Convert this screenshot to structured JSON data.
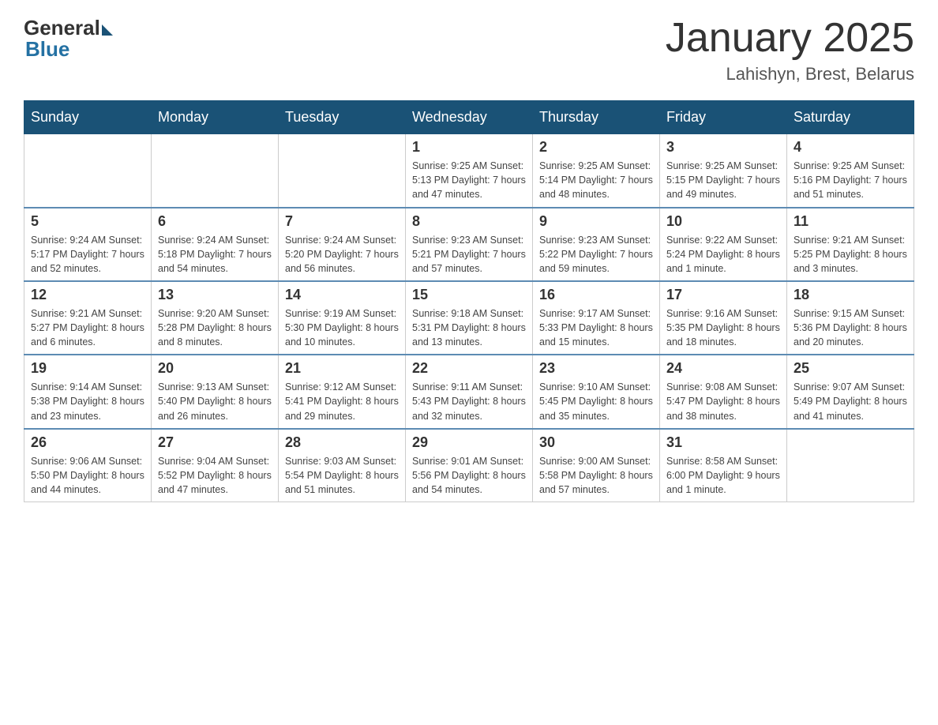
{
  "logo": {
    "general": "General",
    "blue": "Blue"
  },
  "title": "January 2025",
  "location": "Lahishyn, Brest, Belarus",
  "days_of_week": [
    "Sunday",
    "Monday",
    "Tuesday",
    "Wednesday",
    "Thursday",
    "Friday",
    "Saturday"
  ],
  "weeks": [
    [
      {
        "day": "",
        "info": ""
      },
      {
        "day": "",
        "info": ""
      },
      {
        "day": "",
        "info": ""
      },
      {
        "day": "1",
        "info": "Sunrise: 9:25 AM\nSunset: 5:13 PM\nDaylight: 7 hours\nand 47 minutes."
      },
      {
        "day": "2",
        "info": "Sunrise: 9:25 AM\nSunset: 5:14 PM\nDaylight: 7 hours\nand 48 minutes."
      },
      {
        "day": "3",
        "info": "Sunrise: 9:25 AM\nSunset: 5:15 PM\nDaylight: 7 hours\nand 49 minutes."
      },
      {
        "day": "4",
        "info": "Sunrise: 9:25 AM\nSunset: 5:16 PM\nDaylight: 7 hours\nand 51 minutes."
      }
    ],
    [
      {
        "day": "5",
        "info": "Sunrise: 9:24 AM\nSunset: 5:17 PM\nDaylight: 7 hours\nand 52 minutes."
      },
      {
        "day": "6",
        "info": "Sunrise: 9:24 AM\nSunset: 5:18 PM\nDaylight: 7 hours\nand 54 minutes."
      },
      {
        "day": "7",
        "info": "Sunrise: 9:24 AM\nSunset: 5:20 PM\nDaylight: 7 hours\nand 56 minutes."
      },
      {
        "day": "8",
        "info": "Sunrise: 9:23 AM\nSunset: 5:21 PM\nDaylight: 7 hours\nand 57 minutes."
      },
      {
        "day": "9",
        "info": "Sunrise: 9:23 AM\nSunset: 5:22 PM\nDaylight: 7 hours\nand 59 minutes."
      },
      {
        "day": "10",
        "info": "Sunrise: 9:22 AM\nSunset: 5:24 PM\nDaylight: 8 hours\nand 1 minute."
      },
      {
        "day": "11",
        "info": "Sunrise: 9:21 AM\nSunset: 5:25 PM\nDaylight: 8 hours\nand 3 minutes."
      }
    ],
    [
      {
        "day": "12",
        "info": "Sunrise: 9:21 AM\nSunset: 5:27 PM\nDaylight: 8 hours\nand 6 minutes."
      },
      {
        "day": "13",
        "info": "Sunrise: 9:20 AM\nSunset: 5:28 PM\nDaylight: 8 hours\nand 8 minutes."
      },
      {
        "day": "14",
        "info": "Sunrise: 9:19 AM\nSunset: 5:30 PM\nDaylight: 8 hours\nand 10 minutes."
      },
      {
        "day": "15",
        "info": "Sunrise: 9:18 AM\nSunset: 5:31 PM\nDaylight: 8 hours\nand 13 minutes."
      },
      {
        "day": "16",
        "info": "Sunrise: 9:17 AM\nSunset: 5:33 PM\nDaylight: 8 hours\nand 15 minutes."
      },
      {
        "day": "17",
        "info": "Sunrise: 9:16 AM\nSunset: 5:35 PM\nDaylight: 8 hours\nand 18 minutes."
      },
      {
        "day": "18",
        "info": "Sunrise: 9:15 AM\nSunset: 5:36 PM\nDaylight: 8 hours\nand 20 minutes."
      }
    ],
    [
      {
        "day": "19",
        "info": "Sunrise: 9:14 AM\nSunset: 5:38 PM\nDaylight: 8 hours\nand 23 minutes."
      },
      {
        "day": "20",
        "info": "Sunrise: 9:13 AM\nSunset: 5:40 PM\nDaylight: 8 hours\nand 26 minutes."
      },
      {
        "day": "21",
        "info": "Sunrise: 9:12 AM\nSunset: 5:41 PM\nDaylight: 8 hours\nand 29 minutes."
      },
      {
        "day": "22",
        "info": "Sunrise: 9:11 AM\nSunset: 5:43 PM\nDaylight: 8 hours\nand 32 minutes."
      },
      {
        "day": "23",
        "info": "Sunrise: 9:10 AM\nSunset: 5:45 PM\nDaylight: 8 hours\nand 35 minutes."
      },
      {
        "day": "24",
        "info": "Sunrise: 9:08 AM\nSunset: 5:47 PM\nDaylight: 8 hours\nand 38 minutes."
      },
      {
        "day": "25",
        "info": "Sunrise: 9:07 AM\nSunset: 5:49 PM\nDaylight: 8 hours\nand 41 minutes."
      }
    ],
    [
      {
        "day": "26",
        "info": "Sunrise: 9:06 AM\nSunset: 5:50 PM\nDaylight: 8 hours\nand 44 minutes."
      },
      {
        "day": "27",
        "info": "Sunrise: 9:04 AM\nSunset: 5:52 PM\nDaylight: 8 hours\nand 47 minutes."
      },
      {
        "day": "28",
        "info": "Sunrise: 9:03 AM\nSunset: 5:54 PM\nDaylight: 8 hours\nand 51 minutes."
      },
      {
        "day": "29",
        "info": "Sunrise: 9:01 AM\nSunset: 5:56 PM\nDaylight: 8 hours\nand 54 minutes."
      },
      {
        "day": "30",
        "info": "Sunrise: 9:00 AM\nSunset: 5:58 PM\nDaylight: 8 hours\nand 57 minutes."
      },
      {
        "day": "31",
        "info": "Sunrise: 8:58 AM\nSunset: 6:00 PM\nDaylight: 9 hours\nand 1 minute."
      },
      {
        "day": "",
        "info": ""
      }
    ]
  ]
}
